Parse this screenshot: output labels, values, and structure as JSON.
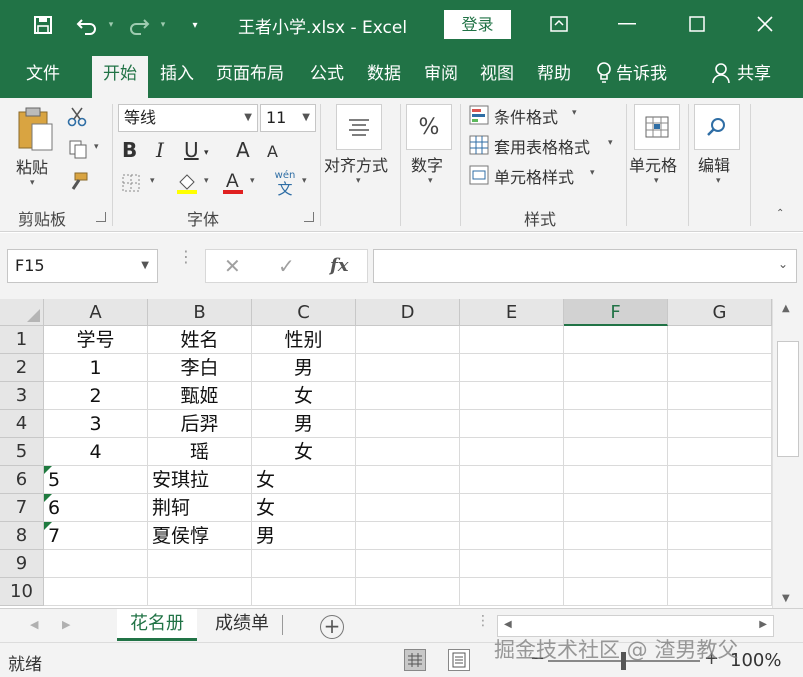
{
  "window": {
    "title": "王者小学.xlsx  -  Excel",
    "login_label": "登录",
    "save_icon": "save-icon",
    "colors": {
      "accent": "#217346",
      "ribbon_bg": "#f3f3f3"
    }
  },
  "ribbon_tabs": [
    "文件",
    "开始",
    "插入",
    "页面布局",
    "公式",
    "数据",
    "审阅",
    "视图",
    "帮助",
    "告诉我",
    "共享"
  ],
  "active_tab": "开始",
  "ribbon": {
    "clipboard": {
      "paste_label": "粘贴",
      "group_label": "剪贴板"
    },
    "font": {
      "font_name": "等线",
      "font_size": "11",
      "group_label": "字体",
      "bold": "B",
      "italic": "I",
      "underline": "U",
      "grow": "A",
      "shrink": "A",
      "phonetic_top": "wén",
      "phonetic_bottom": "文"
    },
    "alignment": {
      "label": "对齐方式"
    },
    "number": {
      "label": "数字",
      "symbol": "%"
    },
    "styles": {
      "conditional": "条件格式",
      "table": "套用表格格式",
      "cell": "单元格样式",
      "group_label": "样式"
    },
    "cells": {
      "label": "单元格"
    },
    "editing": {
      "label": "编辑"
    }
  },
  "formula_bar": {
    "name_box": "F15",
    "cancel": "✕",
    "enter": "✓",
    "fx": "fx",
    "value": ""
  },
  "columns": [
    "A",
    "B",
    "C",
    "D",
    "E",
    "F",
    "G"
  ],
  "selected_column": "F",
  "rows": [
    "1",
    "2",
    "3",
    "4",
    "5",
    "6",
    "7",
    "8",
    "9",
    "10"
  ],
  "cells": [
    [
      {
        "v": "学号",
        "a": "center"
      },
      {
        "v": "姓名",
        "a": "center"
      },
      {
        "v": "性别",
        "a": "center"
      }
    ],
    [
      {
        "v": "1",
        "a": "center"
      },
      {
        "v": "李白",
        "a": "center"
      },
      {
        "v": "男",
        "a": "center"
      }
    ],
    [
      {
        "v": "2",
        "a": "center"
      },
      {
        "v": "甄姬",
        "a": "center"
      },
      {
        "v": "女",
        "a": "center"
      }
    ],
    [
      {
        "v": "3",
        "a": "center"
      },
      {
        "v": "后羿",
        "a": "center"
      },
      {
        "v": "男",
        "a": "center"
      }
    ],
    [
      {
        "v": "4",
        "a": "center"
      },
      {
        "v": "瑶",
        "a": "center"
      },
      {
        "v": "女",
        "a": "center"
      }
    ],
    [
      {
        "v": "5",
        "a": "left",
        "flag": true
      },
      {
        "v": "安琪拉",
        "a": "left"
      },
      {
        "v": "女",
        "a": "left"
      }
    ],
    [
      {
        "v": "6",
        "a": "left",
        "flag": true
      },
      {
        "v": "荆轲",
        "a": "left"
      },
      {
        "v": "女",
        "a": "left"
      }
    ],
    [
      {
        "v": "7",
        "a": "left",
        "flag": true
      },
      {
        "v": "夏侯惇",
        "a": "left"
      },
      {
        "v": "男",
        "a": "left"
      }
    ]
  ],
  "sheets": [
    "花名册",
    "成绩单"
  ],
  "active_sheet": "花名册",
  "status": {
    "ready": "就绪",
    "zoom": "100%",
    "zoom_minus": "−",
    "zoom_plus": "+"
  },
  "watermark": "掘金技术社区 @ 渣男教父"
}
